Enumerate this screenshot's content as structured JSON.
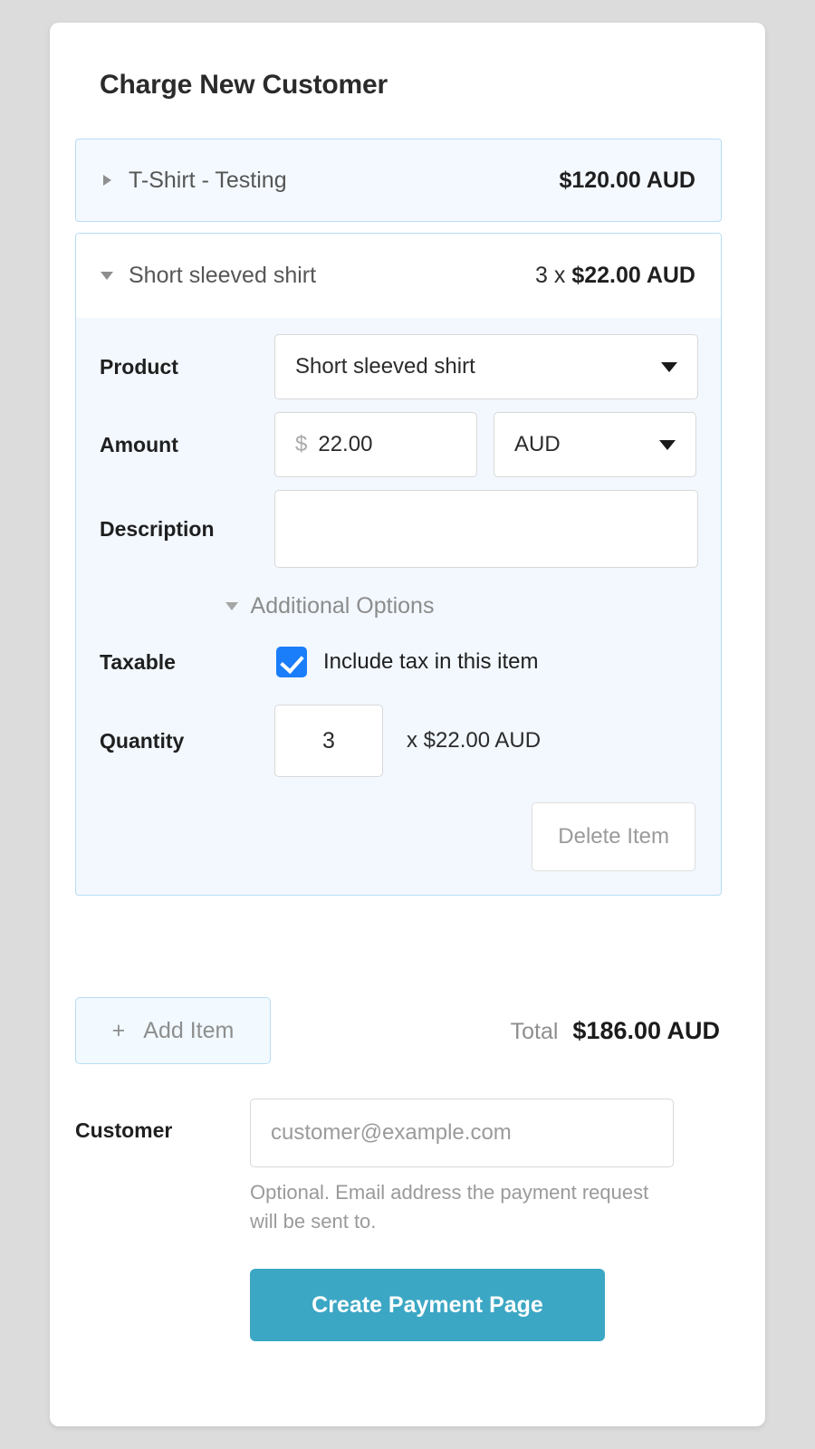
{
  "page": {
    "title": "Charge New Customer",
    "background_color": "#dcdcdc",
    "card_color": "#ffffff"
  },
  "colors": {
    "accent_button": "#3ca7c4",
    "item_border": "#b8ddf5",
    "item_fill": "#f4f9ff",
    "checkbox": "#1a7dfa"
  },
  "items": [
    {
      "name": "T-Shirt - Testing",
      "price_text": "$120.00 AUD",
      "quantity_prefix": "",
      "expanded": false,
      "caret_icon": "triangle-right-icon"
    },
    {
      "name": "Short sleeved shirt",
      "price_text": "$22.00 AUD",
      "quantity_prefix": "3 x ",
      "expanded": true,
      "caret_icon": "triangle-down-icon",
      "form": {
        "product_label": "Product",
        "product_value": "Short sleeved shirt",
        "amount_label": "Amount",
        "amount_symbol": "$",
        "amount_value": "22.00",
        "currency_value": "AUD",
        "description_label": "Description",
        "description_value": "",
        "additional_options_label": "Additional Options",
        "taxable_label": "Taxable",
        "taxable_checkbox_label": "Include tax in this item",
        "taxable_checked": true,
        "quantity_label": "Quantity",
        "quantity_value": "3",
        "quantity_suffix": "x $22.00 AUD",
        "delete_label": "Delete Item"
      }
    }
  ],
  "footer": {
    "add_item_plus": "+",
    "add_item_label": "Add Item",
    "total_label": "Total",
    "total_value": "$186.00 AUD"
  },
  "customer": {
    "label": "Customer",
    "placeholder": "customer@example.com",
    "value": "",
    "help_text": "Optional. Email address the payment request will be sent to."
  },
  "submit": {
    "label": "Create Payment Page"
  }
}
